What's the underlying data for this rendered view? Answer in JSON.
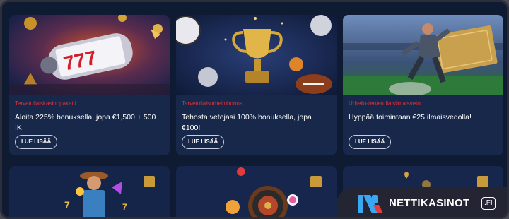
{
  "top_strip": "",
  "cards": [
    {
      "tag": "Tervetuliaiskasinopaketti",
      "title": "Aloita 225% bonuksella, jopa €1,500 + 500 IK",
      "button": "LUE LISÄÄ",
      "image": "slot-machine-777"
    },
    {
      "tag": "Tervetuliaisurheilubonus",
      "title": "Tehosta vetojasi 100% bonuksella, jopa €100!",
      "button": "LUE LISÄÄ",
      "image": "trophy-with-balls"
    },
    {
      "tag": "Urheilu-tervetuliaisilmaisveto",
      "title": "Hyppää toimintaan €25 ilmaisvedolla!",
      "button": "LUE LISÄÄ",
      "image": "football-player-ticket"
    }
  ],
  "bottom_cards": [
    {
      "image": "cowboy-slot"
    },
    {
      "image": "roulette-wheel"
    },
    {
      "image": "gold-gift"
    }
  ],
  "brand": {
    "name": "NETTIKASINOT",
    "tld": ".FI",
    "logo": "nettikasinot-logo-icon"
  },
  "colors": {
    "background": "#0f1a33",
    "card": "#17284a",
    "tag_red": "#e0313b",
    "brand_blue": "#3aa7f2"
  }
}
